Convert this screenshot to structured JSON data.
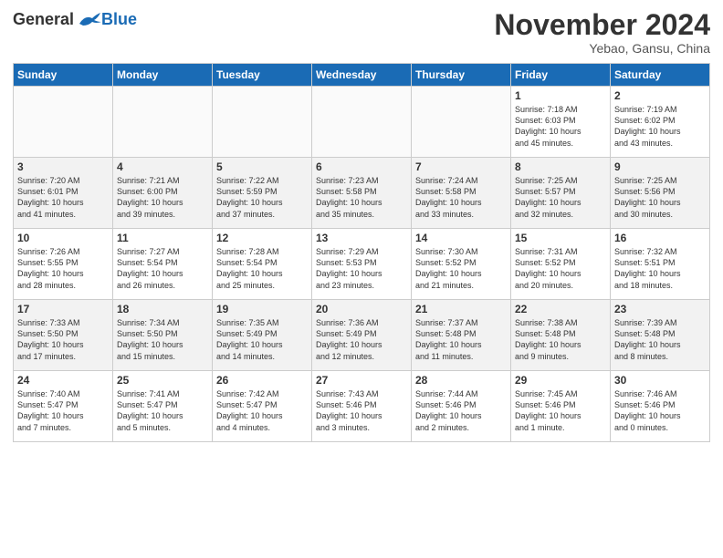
{
  "header": {
    "logo_general": "General",
    "logo_blue": "Blue",
    "month": "November 2024",
    "location": "Yebao, Gansu, China"
  },
  "days_of_week": [
    "Sunday",
    "Monday",
    "Tuesday",
    "Wednesday",
    "Thursday",
    "Friday",
    "Saturday"
  ],
  "weeks": [
    [
      {
        "day": "",
        "info": ""
      },
      {
        "day": "",
        "info": ""
      },
      {
        "day": "",
        "info": ""
      },
      {
        "day": "",
        "info": ""
      },
      {
        "day": "",
        "info": ""
      },
      {
        "day": "1",
        "info": "Sunrise: 7:18 AM\nSunset: 6:03 PM\nDaylight: 10 hours\nand 45 minutes."
      },
      {
        "day": "2",
        "info": "Sunrise: 7:19 AM\nSunset: 6:02 PM\nDaylight: 10 hours\nand 43 minutes."
      }
    ],
    [
      {
        "day": "3",
        "info": "Sunrise: 7:20 AM\nSunset: 6:01 PM\nDaylight: 10 hours\nand 41 minutes."
      },
      {
        "day": "4",
        "info": "Sunrise: 7:21 AM\nSunset: 6:00 PM\nDaylight: 10 hours\nand 39 minutes."
      },
      {
        "day": "5",
        "info": "Sunrise: 7:22 AM\nSunset: 5:59 PM\nDaylight: 10 hours\nand 37 minutes."
      },
      {
        "day": "6",
        "info": "Sunrise: 7:23 AM\nSunset: 5:58 PM\nDaylight: 10 hours\nand 35 minutes."
      },
      {
        "day": "7",
        "info": "Sunrise: 7:24 AM\nSunset: 5:58 PM\nDaylight: 10 hours\nand 33 minutes."
      },
      {
        "day": "8",
        "info": "Sunrise: 7:25 AM\nSunset: 5:57 PM\nDaylight: 10 hours\nand 32 minutes."
      },
      {
        "day": "9",
        "info": "Sunrise: 7:25 AM\nSunset: 5:56 PM\nDaylight: 10 hours\nand 30 minutes."
      }
    ],
    [
      {
        "day": "10",
        "info": "Sunrise: 7:26 AM\nSunset: 5:55 PM\nDaylight: 10 hours\nand 28 minutes."
      },
      {
        "day": "11",
        "info": "Sunrise: 7:27 AM\nSunset: 5:54 PM\nDaylight: 10 hours\nand 26 minutes."
      },
      {
        "day": "12",
        "info": "Sunrise: 7:28 AM\nSunset: 5:54 PM\nDaylight: 10 hours\nand 25 minutes."
      },
      {
        "day": "13",
        "info": "Sunrise: 7:29 AM\nSunset: 5:53 PM\nDaylight: 10 hours\nand 23 minutes."
      },
      {
        "day": "14",
        "info": "Sunrise: 7:30 AM\nSunset: 5:52 PM\nDaylight: 10 hours\nand 21 minutes."
      },
      {
        "day": "15",
        "info": "Sunrise: 7:31 AM\nSunset: 5:52 PM\nDaylight: 10 hours\nand 20 minutes."
      },
      {
        "day": "16",
        "info": "Sunrise: 7:32 AM\nSunset: 5:51 PM\nDaylight: 10 hours\nand 18 minutes."
      }
    ],
    [
      {
        "day": "17",
        "info": "Sunrise: 7:33 AM\nSunset: 5:50 PM\nDaylight: 10 hours\nand 17 minutes."
      },
      {
        "day": "18",
        "info": "Sunrise: 7:34 AM\nSunset: 5:50 PM\nDaylight: 10 hours\nand 15 minutes."
      },
      {
        "day": "19",
        "info": "Sunrise: 7:35 AM\nSunset: 5:49 PM\nDaylight: 10 hours\nand 14 minutes."
      },
      {
        "day": "20",
        "info": "Sunrise: 7:36 AM\nSunset: 5:49 PM\nDaylight: 10 hours\nand 12 minutes."
      },
      {
        "day": "21",
        "info": "Sunrise: 7:37 AM\nSunset: 5:48 PM\nDaylight: 10 hours\nand 11 minutes."
      },
      {
        "day": "22",
        "info": "Sunrise: 7:38 AM\nSunset: 5:48 PM\nDaylight: 10 hours\nand 9 minutes."
      },
      {
        "day": "23",
        "info": "Sunrise: 7:39 AM\nSunset: 5:48 PM\nDaylight: 10 hours\nand 8 minutes."
      }
    ],
    [
      {
        "day": "24",
        "info": "Sunrise: 7:40 AM\nSunset: 5:47 PM\nDaylight: 10 hours\nand 7 minutes."
      },
      {
        "day": "25",
        "info": "Sunrise: 7:41 AM\nSunset: 5:47 PM\nDaylight: 10 hours\nand 5 minutes."
      },
      {
        "day": "26",
        "info": "Sunrise: 7:42 AM\nSunset: 5:47 PM\nDaylight: 10 hours\nand 4 minutes."
      },
      {
        "day": "27",
        "info": "Sunrise: 7:43 AM\nSunset: 5:46 PM\nDaylight: 10 hours\nand 3 minutes."
      },
      {
        "day": "28",
        "info": "Sunrise: 7:44 AM\nSunset: 5:46 PM\nDaylight: 10 hours\nand 2 minutes."
      },
      {
        "day": "29",
        "info": "Sunrise: 7:45 AM\nSunset: 5:46 PM\nDaylight: 10 hours\nand 1 minute."
      },
      {
        "day": "30",
        "info": "Sunrise: 7:46 AM\nSunset: 5:46 PM\nDaylight: 10 hours\nand 0 minutes."
      }
    ]
  ]
}
